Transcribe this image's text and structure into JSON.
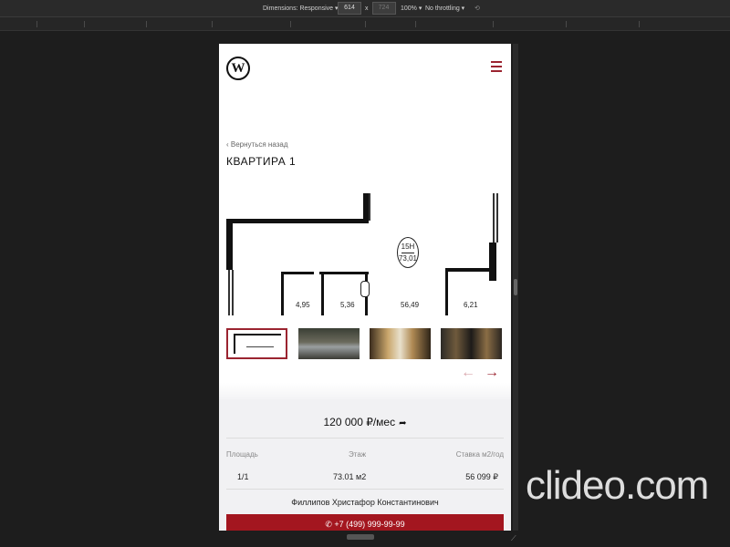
{
  "devtools": {
    "dimensions": "Dimensions: Responsive ▾",
    "width": "614",
    "times": "x",
    "height": "724",
    "zoom": "100% ▾",
    "throttle": "No throttling ▾"
  },
  "site": {
    "back_label": "‹  Вернуться назад",
    "page_title": "КВАРТИРА 1"
  },
  "plan": {
    "unit_code": "15Н",
    "unit_area": "73,01",
    "rooms": [
      "4,95",
      "5,36",
      "56,49",
      "6,21"
    ]
  },
  "gallery": {
    "prev": "←",
    "next": "→"
  },
  "details": {
    "price": "120 000 ₽/мес",
    "share_icon": "➦",
    "columns": [
      "Площадь",
      "Этаж",
      "Ставка м2/год"
    ],
    "values": [
      "1/1",
      "73.01 м2",
      "56 099 ₽"
    ],
    "agent": "Филлипов Христафор Константинович",
    "phone": "+7 (499) 999-99-99"
  },
  "watermark": "clideo.com",
  "colors": {
    "accent": "#9b2430",
    "button": "#a3161f",
    "panel": "#f1f1f3"
  }
}
